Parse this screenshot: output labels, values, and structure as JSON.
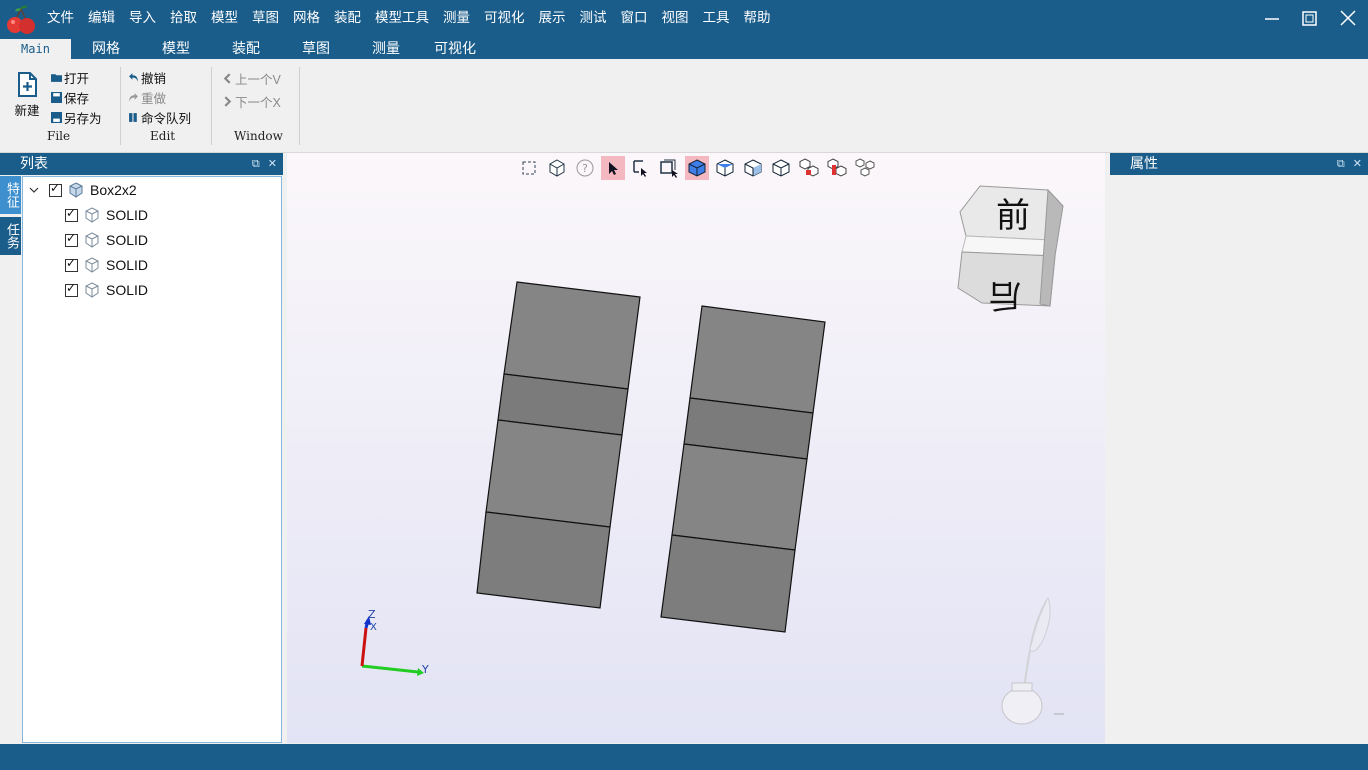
{
  "menu": [
    "文件",
    "编辑",
    "导入",
    "拾取",
    "模型",
    "草图",
    "网格",
    "装配",
    "模型工具",
    "测量",
    "可视化",
    "展示",
    "测试",
    "窗口",
    "视图",
    "工具",
    "帮助"
  ],
  "ribbon_tabs": [
    "Main",
    "网格",
    "模型",
    "装配",
    "草图",
    "测量",
    "可视化"
  ],
  "ribbon": {
    "file": {
      "new": "新建",
      "open": "打开",
      "save": "保存",
      "save_as": "另存为",
      "label": "File"
    },
    "edit": {
      "undo": "撤销",
      "redo": "重做",
      "queue": "命令队列",
      "label": "Edit"
    },
    "window": {
      "prev": "上一个V",
      "next": "下一个X",
      "label": "Window"
    }
  },
  "left_dock": {
    "title": "列表",
    "side_tabs": [
      "特征",
      "任务"
    ],
    "tree": {
      "root": "Box2x2",
      "children": [
        "SOLID",
        "SOLID",
        "SOLID",
        "SOLID"
      ]
    }
  },
  "right_dock": {
    "title": "属性"
  },
  "viewcube": {
    "top_face": "前",
    "bottom_face": "后"
  },
  "triad": {
    "z": "Z",
    "x": "X",
    "y": "Y"
  },
  "colors": {
    "chrome": "#1a5c8a",
    "solid_face": "#808080",
    "selected_tool": "#f3b8c0"
  },
  "icons": {
    "viewport_toolbar": [
      "fit-all-icon",
      "view-iso-icon",
      "help-icon",
      "select-arrow-icon",
      "box-select-icon",
      "window-select-icon",
      "shaded-icon",
      "shaded-edges-icon",
      "wireframe-icon",
      "hidden-line-icon",
      "section-icon",
      "section-red-icon",
      "explode-icon"
    ]
  }
}
